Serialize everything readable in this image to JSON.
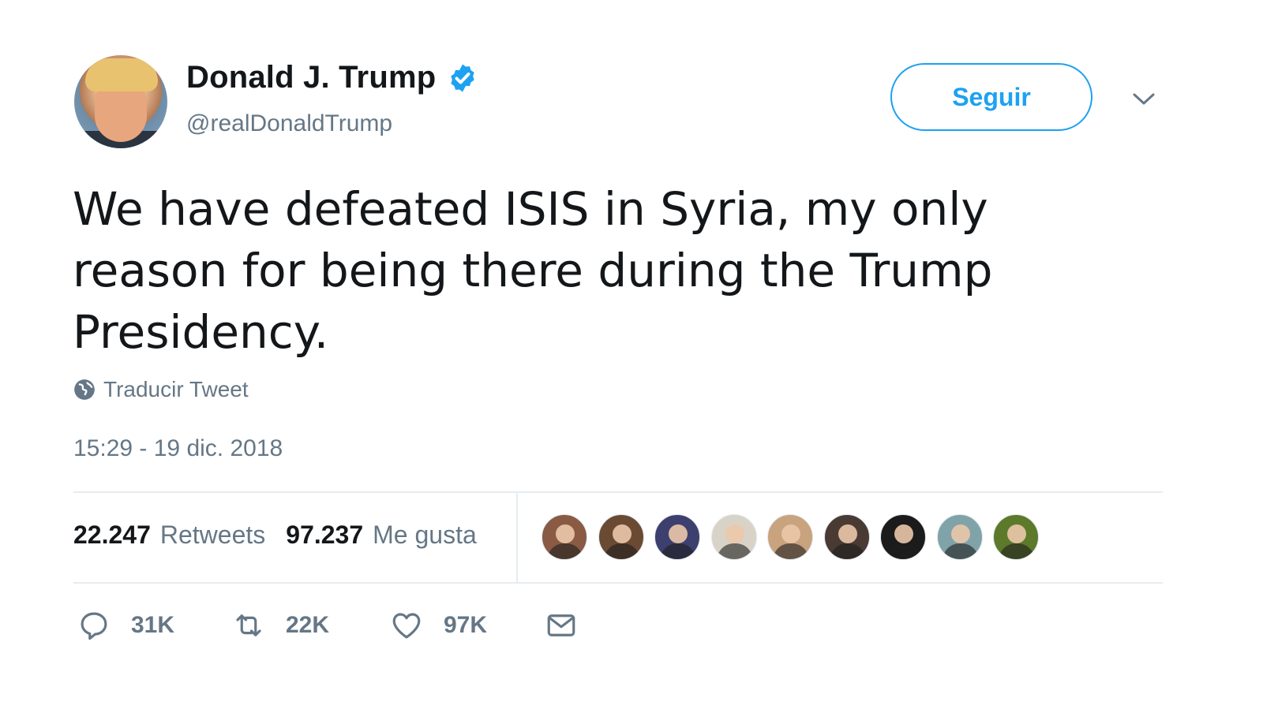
{
  "user": {
    "display_name": "Donald J. Trump",
    "handle": "@realDonaldTrump",
    "verified_icon": "verified-badge-icon",
    "verified_color": "#1da1f2"
  },
  "follow_button": {
    "label": "Seguir"
  },
  "menu": {
    "icon": "chevron-down-icon"
  },
  "tweet": {
    "text": "We have defeated ISIS in Syria, my only reason for being there during the Trump Presidency.",
    "translate_label": "Traducir Tweet",
    "timestamp": "15:29 - 19 dic. 2018"
  },
  "stats": {
    "retweets_count": "22.247",
    "retweets_label": "Retweets",
    "likes_count": "97.237",
    "likes_label": "Me gusta"
  },
  "likers": [
    {
      "color": "#8a5a44"
    },
    {
      "color": "#6b4a33"
    },
    {
      "color": "#3d3f6e"
    },
    {
      "color": "#d9d3c7"
    },
    {
      "color": "#c9a27e"
    },
    {
      "color": "#4a3a34"
    },
    {
      "color": "#1b1b1b"
    },
    {
      "color": "#7fa3a8"
    },
    {
      "color": "#5c7a2a"
    }
  ],
  "actions": {
    "reply_count": "31K",
    "retweet_count": "22K",
    "like_count": "97K"
  },
  "colors": {
    "accent": "#1da1f2",
    "muted": "#657786",
    "text": "#14171a",
    "divider": "#e6ecf0"
  }
}
